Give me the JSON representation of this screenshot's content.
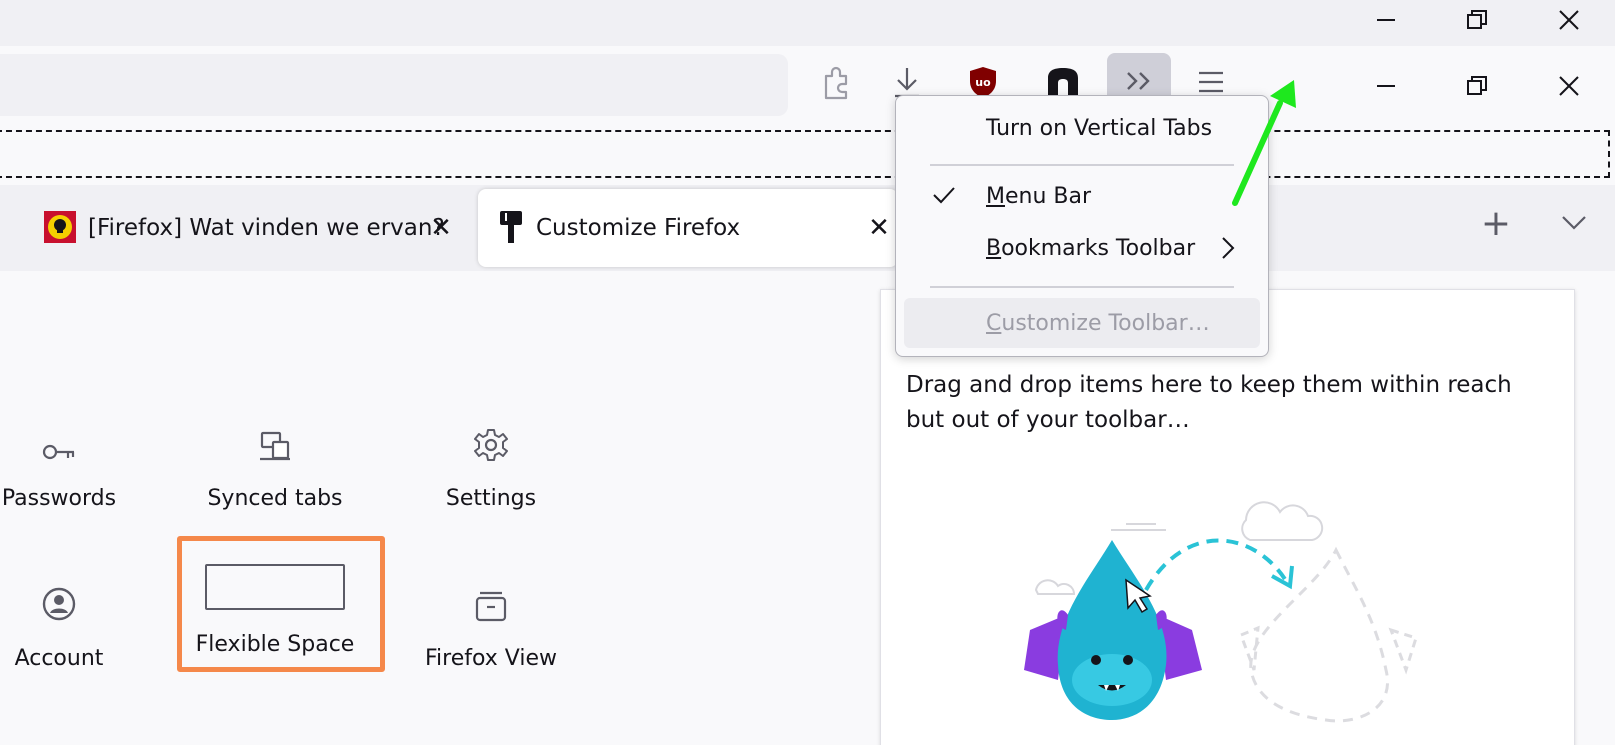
{
  "window_controls": {
    "icons": [
      "minimize-icon",
      "restore-icon",
      "close-icon"
    ]
  },
  "toolbar": {
    "icons": [
      "extensions-icon",
      "downloads-icon",
      "ublock-origin-icon",
      "extension-icon",
      "overflow-chevrons-icon",
      "app-menu-icon"
    ]
  },
  "tabs": [
    {
      "title": "[Firefox] Wat vinden we ervan? - Seniorweb",
      "icon": "seniorweb-favicon",
      "close": "✕"
    },
    {
      "title": "Customize Firefox",
      "icon": "paintbrush-icon",
      "close": "✕"
    }
  ],
  "tabstrip": {
    "new_tab": "+",
    "list_tabs": "chevron-down-icon"
  },
  "palette": [
    {
      "label": "Passwords",
      "icon": "key-icon"
    },
    {
      "label": "Synced tabs",
      "icon": "synced-tabs-icon"
    },
    {
      "label": "Settings",
      "icon": "gear-icon"
    },
    {
      "label": "Account",
      "icon": "account-icon"
    },
    {
      "label": "Flexible Space",
      "icon": "flexible-space"
    },
    {
      "label": "Firefox View",
      "icon": "firefox-view-icon"
    }
  ],
  "overflow_panel": {
    "text": "Drag and drop items here to keep them within reach but out of your toolbar…"
  },
  "context_menu": {
    "vertical_tabs": "Turn on Vertical Tabs",
    "menu_bar": {
      "pre": "",
      "u": "M",
      "post": "enu Bar",
      "checked": true
    },
    "bookmarks_toolbar": {
      "pre": "",
      "u": "B",
      "post": "ookmarks Toolbar"
    },
    "customize": {
      "pre": "",
      "u": "C",
      "post": "ustomize Toolbar…"
    }
  },
  "colors": {
    "highlight_border": "#f5884a",
    "annotation_arrow": "#1ee81e",
    "overflow_button_bg": "#cfcfd8",
    "ublock_red": "#800000"
  }
}
